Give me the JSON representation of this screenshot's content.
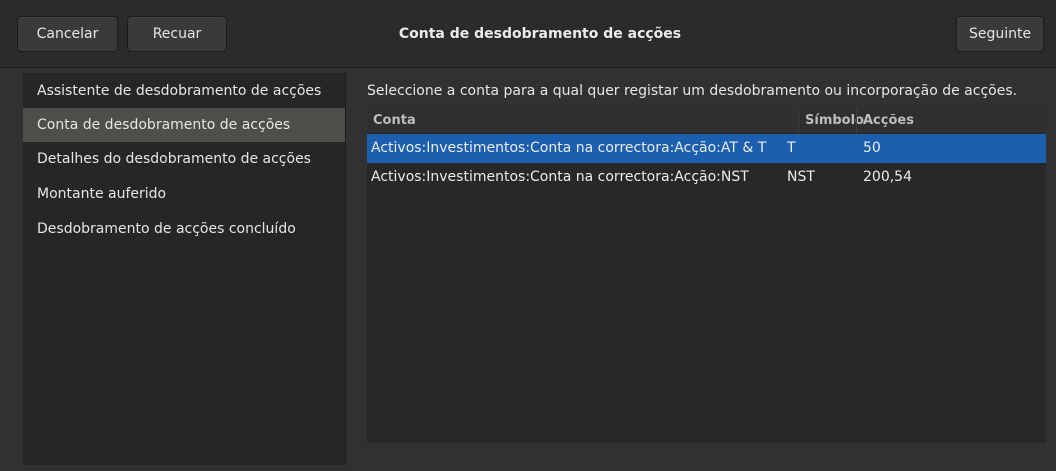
{
  "header": {
    "cancel_label": "Cancelar",
    "back_label": "Recuar",
    "title": "Conta de desdobramento de acções",
    "next_label": "Seguinte"
  },
  "sidebar": {
    "items": [
      {
        "label": "Assistente de desdobramento de acções"
      },
      {
        "label": "Conta de desdobramento de acções"
      },
      {
        "label": "Detalhes do desdobramento de acções"
      },
      {
        "label": "Montante auferido"
      },
      {
        "label": "Desdobramento de acções concluído"
      }
    ],
    "selected_index": 1
  },
  "main": {
    "instructions": "Seleccione a conta para a qual quer registar um desdobramento ou incorporação de acções.",
    "table": {
      "columns": [
        "Conta",
        "Símbolo",
        "Acções"
      ],
      "rows": [
        {
          "conta": "Activos:Investimentos:Conta na correctora:Acção:AT & T",
          "simbolo": "T",
          "accoes": "50",
          "selected": true
        },
        {
          "conta": "Activos:Investimentos:Conta na correctora:Acção:NST",
          "simbolo": "NST",
          "accoes": "200,54",
          "selected": false
        }
      ]
    }
  },
  "colors": {
    "selection": "#1b5fae",
    "sidebar_selected": "#4e4e4a",
    "background": "#2e2e2e"
  }
}
